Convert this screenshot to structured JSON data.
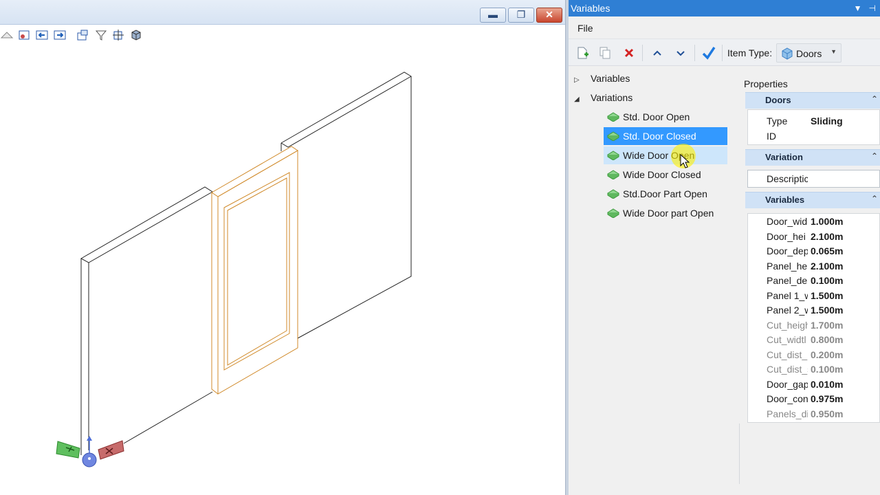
{
  "viewport": {
    "window_buttons": {
      "minimize": "▬",
      "restore": "❐",
      "close": "✕"
    }
  },
  "panel": {
    "title": "Variables",
    "menu": {
      "file": "File"
    },
    "toolbar": {
      "item_type_label": "Item Type:",
      "item_type_value": "Doors"
    },
    "tree": {
      "variables_label": "Variables",
      "variations_label": "Variations",
      "items": [
        {
          "label": "Std. Door Open",
          "state": "normal"
        },
        {
          "label": "Std. Door Closed",
          "state": "selected"
        },
        {
          "label": "Wide Door Open",
          "state": "hover"
        },
        {
          "label": "Wide Door Closed",
          "state": "normal"
        },
        {
          "label": "Std.Door Part Open",
          "state": "normal"
        },
        {
          "label": "Wide Door part Open",
          "state": "normal"
        }
      ]
    },
    "properties": {
      "label": "Properties",
      "doors_section": {
        "title": "Doors",
        "rows": [
          {
            "key": "Type",
            "value": "Sliding"
          },
          {
            "key": "ID",
            "value": ""
          }
        ]
      },
      "variation_section": {
        "title": "Variation",
        "description_label": "Descriptic"
      },
      "variables_section": {
        "title": "Variables",
        "rows": [
          {
            "key": "Door_wid",
            "value": "1.000m"
          },
          {
            "key": "Door_hei",
            "value": "2.100m"
          },
          {
            "key": "Door_dep",
            "value": "0.065m"
          },
          {
            "key": "Panel_hei",
            "value": "2.100m"
          },
          {
            "key": "Panel_dep",
            "value": "0.100m"
          },
          {
            "key": "Panel 1_w",
            "value": "1.500m"
          },
          {
            "key": "Panel 2_w",
            "value": "1.500m"
          },
          {
            "key": "Cut_heigh",
            "value": "1.700m"
          },
          {
            "key": "Cut_widtl",
            "value": "0.800m"
          },
          {
            "key": "Cut_dist_l",
            "value": "0.200m"
          },
          {
            "key": "Cut_dist_s",
            "value": "0.100m"
          },
          {
            "key": "Door_gap",
            "value": "0.010m"
          },
          {
            "key": "Door_con",
            "value": "0.975m"
          },
          {
            "key": "Panels_di",
            "value": "0.950m"
          }
        ],
        "dim_rows": [
          7,
          8,
          9,
          10,
          13
        ]
      }
    }
  },
  "colors": {
    "title_bar": "#2f7fd4",
    "selection": "#3399ff",
    "hover": "#cde6fb",
    "section_header": "#d0e2f6",
    "door_outline": "#d08a2a",
    "axis_x": "#c0504d",
    "axis_y": "#4caf50",
    "axis_z": "#4e6fd8"
  }
}
